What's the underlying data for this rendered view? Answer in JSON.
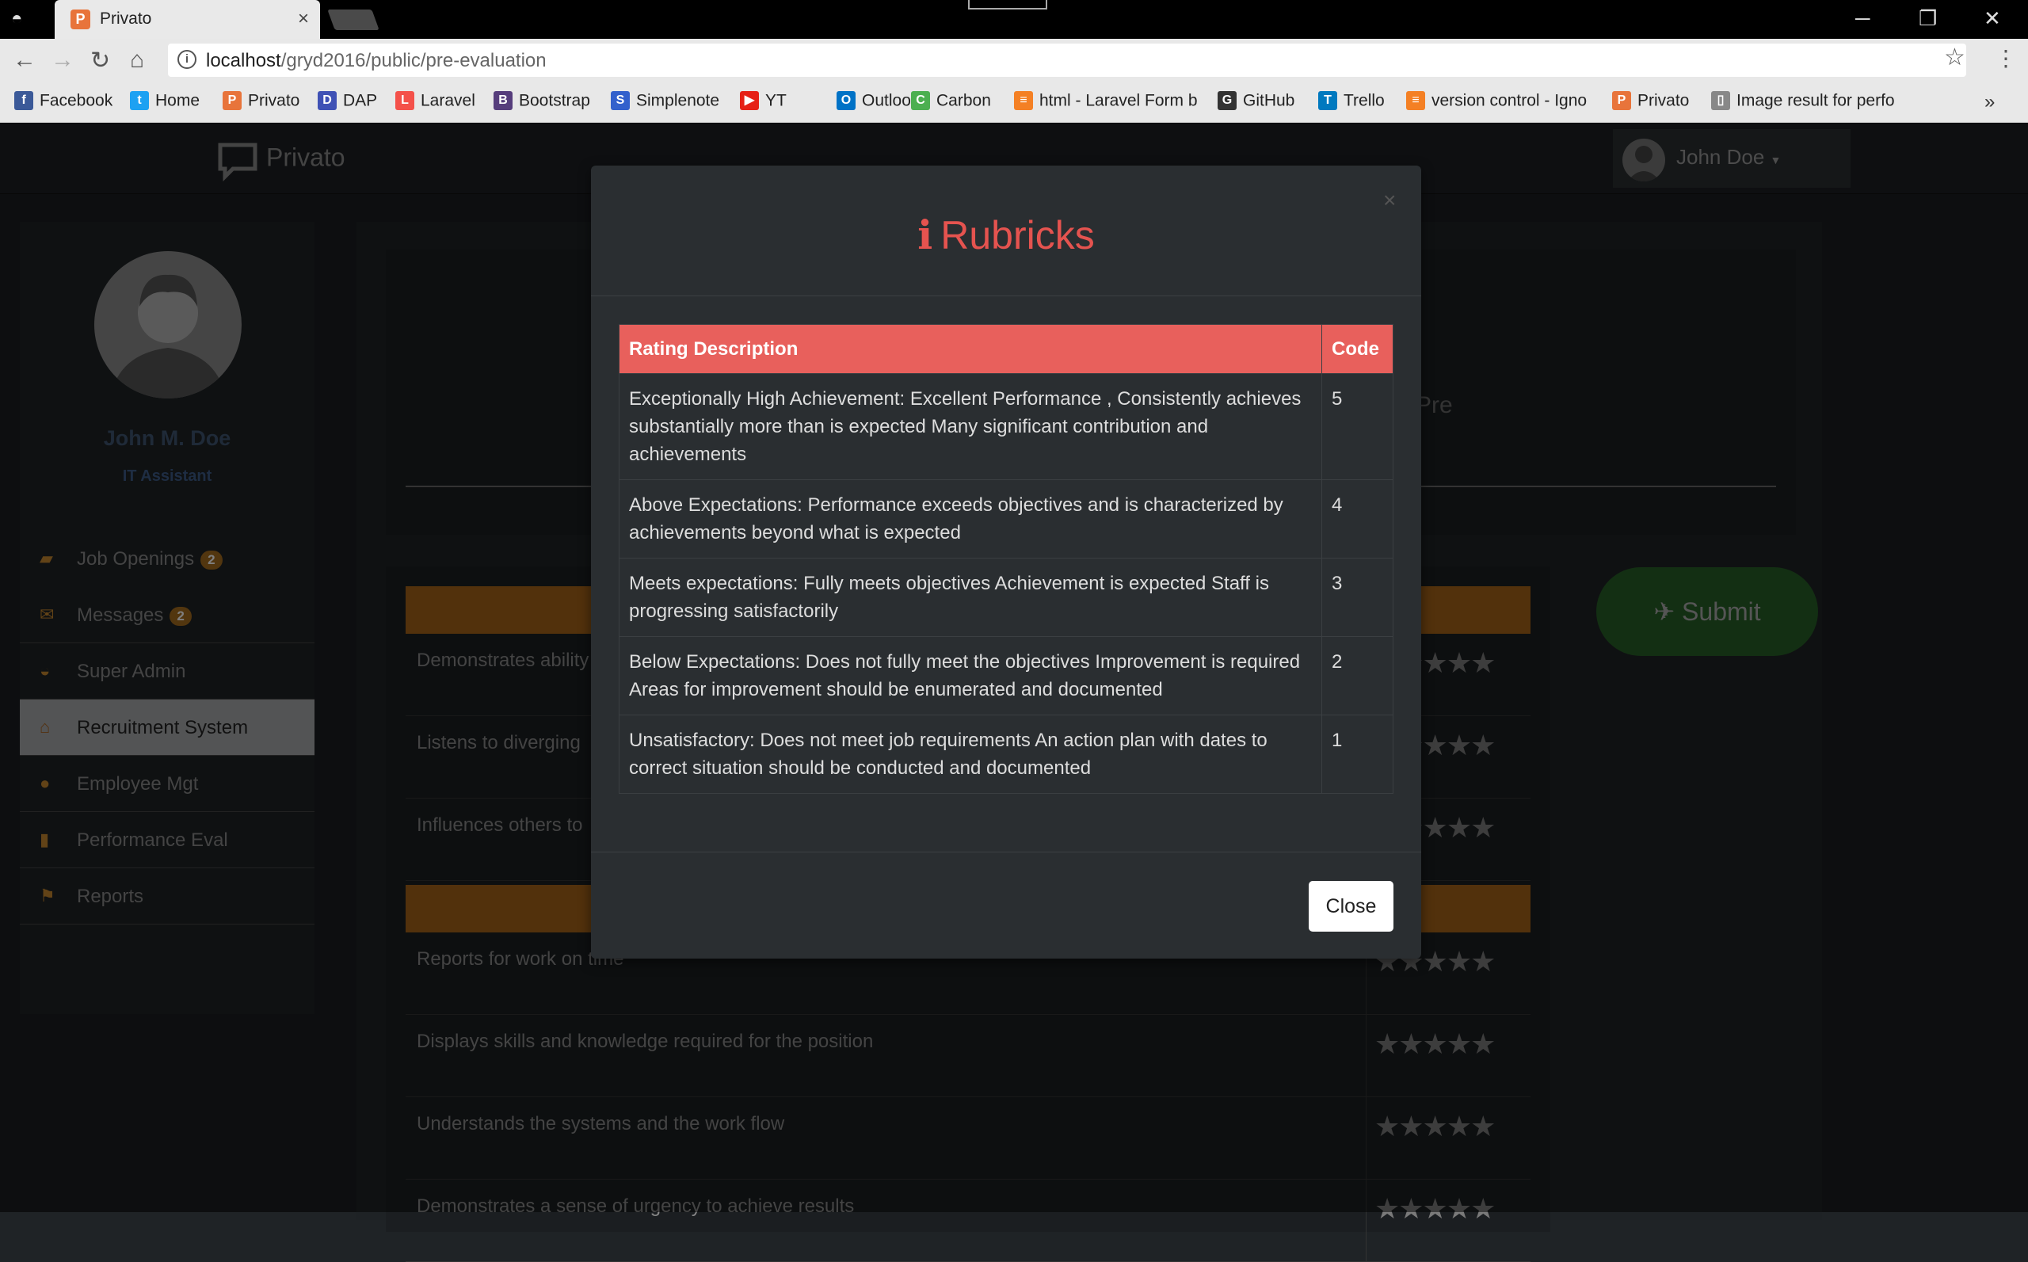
{
  "browser": {
    "tab_title": "Privato",
    "tab_close": "×",
    "url_host": "localhost",
    "url_path": "/gryd2016/public/pre-evaluation",
    "bookmarks": [
      {
        "label": "Facebook",
        "color": "#3b5998",
        "glyph": "f"
      },
      {
        "label": "Home",
        "color": "#1da1f2",
        "glyph": "t"
      },
      {
        "label": "Privato",
        "color": "#e8743b",
        "glyph": "P"
      },
      {
        "label": "DAP",
        "color": "#3f51b5",
        "glyph": "D"
      },
      {
        "label": "Laravel",
        "color": "#f4514a",
        "glyph": "L"
      },
      {
        "label": "Bootstrap",
        "color": "#563d7c",
        "glyph": "B"
      },
      {
        "label": "Simplenote",
        "color": "#3361cc",
        "glyph": "S"
      },
      {
        "label": "YT",
        "color": "#e62117",
        "glyph": "▶"
      },
      {
        "label": "Outlook",
        "color": "#0072c6",
        "glyph": "O"
      },
      {
        "label": "Carbon",
        "color": "#4caf50",
        "glyph": "C"
      },
      {
        "label": "html - Laravel Form b",
        "color": "#f48024",
        "glyph": "≡"
      },
      {
        "label": "GitHub",
        "color": "#333333",
        "glyph": "G"
      },
      {
        "label": "Trello",
        "color": "#0079bf",
        "glyph": "T"
      },
      {
        "label": "version control - Igno",
        "color": "#f48024",
        "glyph": "≡"
      },
      {
        "label": "Privato",
        "color": "#e8743b",
        "glyph": "P"
      },
      {
        "label": "Image result for perfo",
        "color": "#888888",
        "glyph": "▯"
      }
    ],
    "more": "»"
  },
  "app": {
    "brand": "Privato",
    "user_menu": "John Doe",
    "profile": {
      "name": "John M. Doe",
      "role": "IT Assistant"
    },
    "menu": [
      {
        "label": "Job Openings",
        "icon": "briefcase-icon",
        "badge": "2"
      },
      {
        "label": "Messages",
        "icon": "envelope-icon",
        "badge": "2"
      },
      {
        "label": "Super Admin",
        "icon": "sunglasses-icon",
        "badge": ""
      },
      {
        "label": "Recruitment System",
        "icon": "home-icon",
        "badge": ""
      },
      {
        "label": "Employee Mgt",
        "icon": "user-icon",
        "badge": ""
      },
      {
        "label": "Performance Eval",
        "icon": "bar-chart-icon",
        "badge": ""
      },
      {
        "label": "Reports",
        "icon": "flag-icon",
        "badge": ""
      }
    ],
    "active_menu": "Recruitment System",
    "pre_text": "Pre",
    "questions_group1": [
      "Demonstrates ability",
      "Listens to diverging",
      "Influences others to"
    ],
    "questions_group2": [
      "Reports for work on time",
      "Displays skills and knowledge required for the position",
      "Understands the systems and the work flow",
      "Demonstrates a sense of urgency to achieve results"
    ],
    "stars": "★★★★★",
    "submit_label": "Submit"
  },
  "modal": {
    "title": "Rubricks",
    "close_x": "×",
    "columns": [
      "Rating Description",
      "Code"
    ],
    "rows": [
      {
        "description": "Exceptionally High Achievement: Excellent Performance , Consistently achieves substantially more than is expected Many significant contribution and achievements",
        "code": "5"
      },
      {
        "description": "Above Expectations: Performance exceeds objectives and is characterized by achievements beyond what is expected",
        "code": "4"
      },
      {
        "description": "Meets expectations: Fully meets objectives Achievement is expected Staff is progressing satisfactorily",
        "code": "3"
      },
      {
        "description": "Below Expectations: Does not fully meet the objectives Improvement is required Areas for improvement should be enumerated and documented",
        "code": "2"
      },
      {
        "description": "Unsatisfactory: Does not meet job requirements An action plan with dates to correct situation should be conducted and documented",
        "code": "1"
      }
    ],
    "close_label": "Close"
  }
}
